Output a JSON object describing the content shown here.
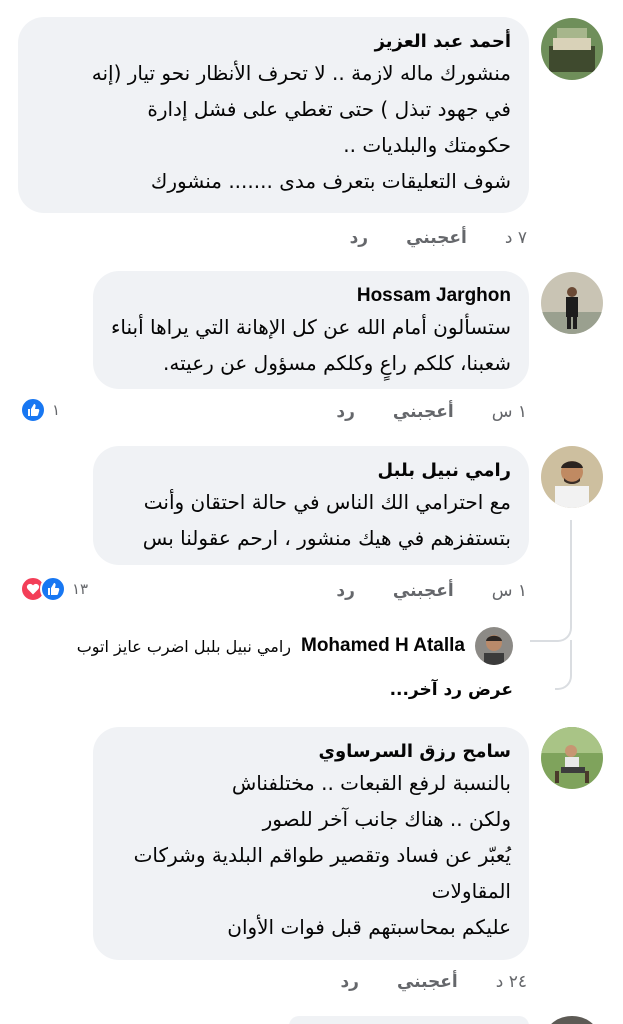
{
  "comments": [
    {
      "author": "أحمد عبد العزيز",
      "text": "منشورك ماله لازمة .. لا تحرف الأنظار نحو تيار (إنه\nفي جهود تبذل ) حتى تغطي على فشل إدارة\nحكومتك والبلديات ..\nشوف  التعليقات بتعرف مدى ....... منشورك",
      "time": "٧ د",
      "like_label": "أعجبني",
      "reply_label": "رد"
    },
    {
      "author": "Hossam Jarghon",
      "text": "ستسألون أمام الله عن كل الإهانة التي يراها أبناء\nشعبنا، كلكم راعٍ وكلكم مسؤول عن رعيته.",
      "time": "١ س",
      "like_label": "أعجبني",
      "reply_label": "رد",
      "reaction_count": "١"
    },
    {
      "author": "رامي نبيل بلبل",
      "text": "مع احترامي الك الناس في حالة احتقان وأنت\nبتستفزهم في هيك منشور ، ارحم عقولنا بس",
      "time": "١ س",
      "like_label": "أعجبني",
      "reply_label": "رد",
      "reaction_count": "١٣",
      "reply": {
        "author": "Mohamed H Atalla",
        "text": "رامي نبيل بلبل اضرب عايز اتوب"
      },
      "more_replies": "عرض رد آخر..."
    },
    {
      "author": "سامح رزق السرساوي",
      "text": "بالنسبة لرفع القبعات .. مختلفناش\nولكن .. هناك جانب آخر للصور\nيُعبّر عن فساد وتقصير طواقم البلدية وشركات\nالمقاولات\nعليكم بمحاسبتهم قبل فوات الأوان",
      "time": "٢٤ د",
      "like_label": "أعجبني",
      "reply_label": "رد"
    }
  ],
  "colors": {
    "bubble": "#f0f2f5",
    "meta_text": "#65676b",
    "like_blue": "#1877f2",
    "love_red": "#f33e58"
  }
}
